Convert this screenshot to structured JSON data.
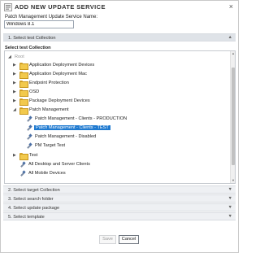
{
  "dialog": {
    "title": "Add New Update Service",
    "close_glyph": "×",
    "title_icon": "wizard-icon"
  },
  "name_field": {
    "label": "Patch Management Update Service Name:",
    "value": "Windows 8.1"
  },
  "sections": [
    {
      "label": "1. Select test Collection",
      "expanded": true
    },
    {
      "label": "2. Select target Collection",
      "expanded": false
    },
    {
      "label": "3. Select search folder",
      "expanded": false
    },
    {
      "label": "4. Select update package",
      "expanded": false
    },
    {
      "label": "5. Select template",
      "expanded": false
    }
  ],
  "collection_picker": {
    "heading": "Select test Collection",
    "root_label": "Root",
    "nodes": [
      {
        "label": "Application Deployment Devices",
        "type": "folder",
        "expander": "▶"
      },
      {
        "label": "Application Deployment Mac",
        "type": "folder",
        "expander": "▶"
      },
      {
        "label": "Endpoint Protection",
        "type": "folder",
        "expander": "▶"
      },
      {
        "label": "OSD",
        "type": "folder",
        "expander": "▶"
      },
      {
        "label": "Package Deployment Devices",
        "type": "folder",
        "expander": "▶"
      },
      {
        "label": "Patch Management",
        "type": "folder",
        "expander": "◢"
      },
      {
        "label": "Patch Management - Clients - PRODUCTION",
        "type": "collection"
      },
      {
        "label": "Patch Management - Clients - TEST",
        "type": "collection",
        "selected": true
      },
      {
        "label": "Patch Management - Disabled",
        "type": "collection"
      },
      {
        "label": "PM Target Test",
        "type": "collection"
      },
      {
        "label": "Test",
        "type": "folder",
        "expander": "▶"
      },
      {
        "label": "All Desktop and Server Clients",
        "type": "collection"
      },
      {
        "label": "All Mobile Devices",
        "type": "collection"
      }
    ]
  },
  "buttons": {
    "save": "Save",
    "cancel": "Cancel"
  },
  "colors": {
    "selection": "#1f7ad0",
    "section_header": "#eef0f3",
    "folder": "#f2c94c"
  }
}
